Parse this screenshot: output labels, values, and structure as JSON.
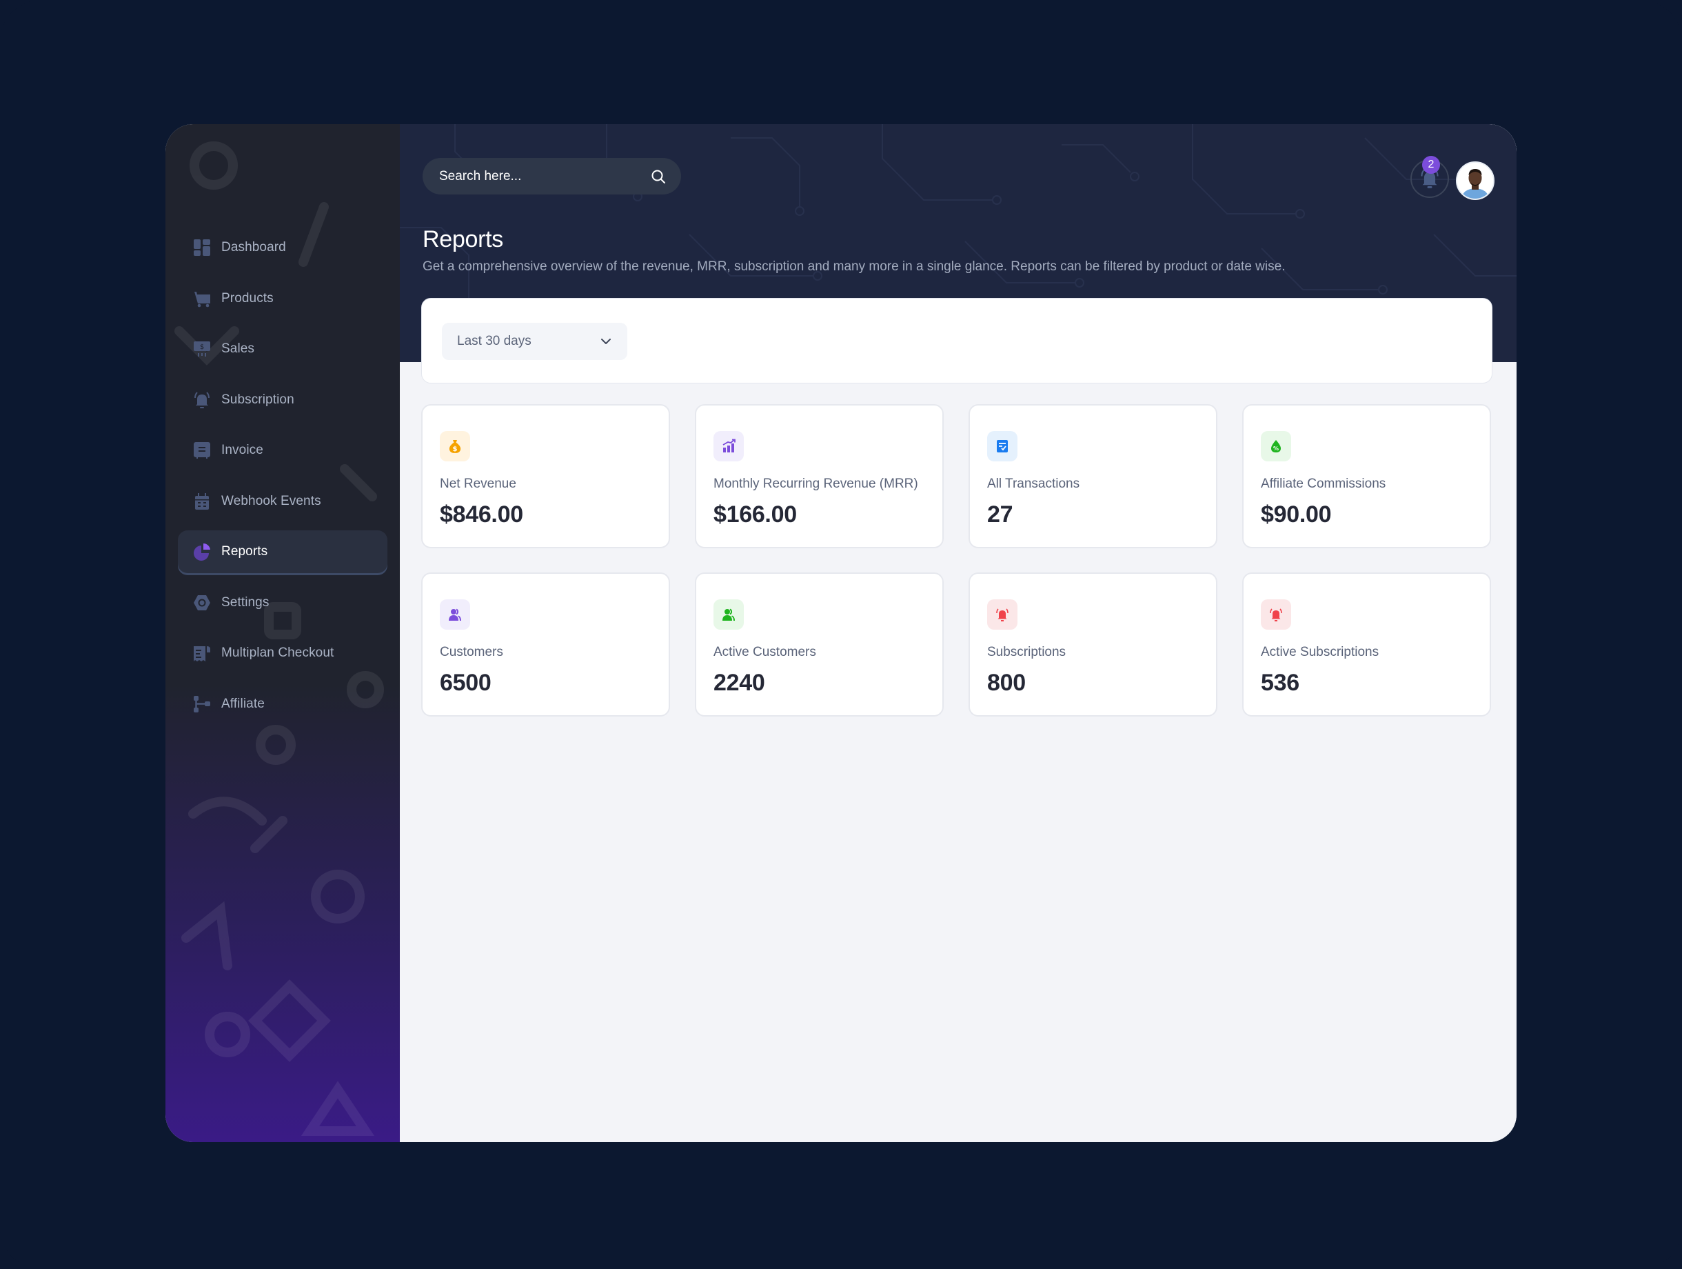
{
  "sidebar": {
    "items": [
      {
        "label": "Dashboard",
        "icon": "dashboard-icon",
        "active": false
      },
      {
        "label": "Products",
        "icon": "cart-icon",
        "active": false
      },
      {
        "label": "Sales",
        "icon": "sales-icon",
        "active": false
      },
      {
        "label": "Subscription",
        "icon": "bell-icon",
        "active": false
      },
      {
        "label": "Invoice",
        "icon": "invoice-icon",
        "active": false
      },
      {
        "label": "Webhook Events",
        "icon": "calendar-icon",
        "active": false
      },
      {
        "label": "Reports",
        "icon": "pie-chart-icon",
        "active": true
      },
      {
        "label": "Settings",
        "icon": "settings-icon",
        "active": false
      },
      {
        "label": "Multiplan Checkout",
        "icon": "receipt-icon",
        "active": false
      },
      {
        "label": "Affiliate",
        "icon": "affiliate-icon",
        "active": false
      }
    ]
  },
  "header": {
    "search_placeholder": "Search here...",
    "notification_count": "2"
  },
  "page": {
    "title": "Reports",
    "description": "Get a comprehensive overview of the revenue, MRR, subscription and many more in a single glance. Reports can be filtered by product or date wise."
  },
  "filter": {
    "date_range": "Last 30 days"
  },
  "stats": [
    {
      "label": "Net Revenue",
      "value": "$846.00",
      "icon": "money-bag-icon",
      "color": "#f5a200",
      "bg": "#fff3df"
    },
    {
      "label": "Monthly Recurring Revenue (MRR)",
      "value": "$166.00",
      "icon": "growth-chart-icon",
      "color": "#7c4ddb",
      "bg": "#f1eefc"
    },
    {
      "label": "All Transactions",
      "value": "27",
      "icon": "transactions-icon",
      "color": "#1a7cf0",
      "bg": "#e5f1fd"
    },
    {
      "label": "Affiliate Commissions",
      "value": "$90.00",
      "icon": "commission-icon",
      "color": "#1fb41f",
      "bg": "#e8f8e8"
    },
    {
      "label": "Customers",
      "value": "6500",
      "icon": "users-icon",
      "color": "#7c4ddb",
      "bg": "#f1eefc"
    },
    {
      "label": "Active Customers",
      "value": "2240",
      "icon": "users-icon",
      "color": "#1fb41f",
      "bg": "#e8f8e8"
    },
    {
      "label": "Subscriptions",
      "value": "800",
      "icon": "alarm-bell-icon",
      "color": "#f0424a",
      "bg": "#fbe7e8"
    },
    {
      "label": "Active Subscriptions",
      "value": "536",
      "icon": "alarm-bell-icon",
      "color": "#f0424a",
      "bg": "#fbe7e8"
    }
  ]
}
